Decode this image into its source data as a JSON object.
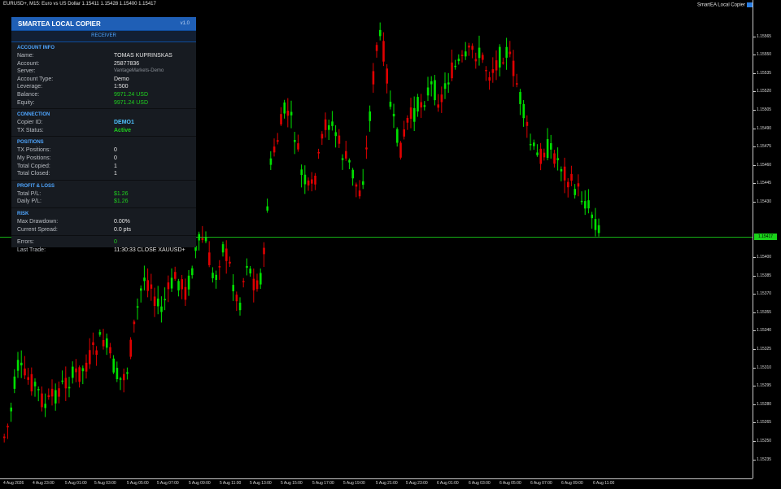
{
  "chart": {
    "title": "EURUSD+, M15:  Euro vs US Dollar  1.15411 1.15428 1.15400 1.15417",
    "ea_label": "SmartEA Local Copier",
    "current_price": "1.15417"
  },
  "price_axis": [
    "1.15565",
    "1.15550",
    "1.15535",
    "1.15520",
    "1.15505",
    "1.15490",
    "1.15475",
    "1.15460",
    "1.15445",
    "1.15430",
    "1.15400",
    "1.15385",
    "1.15370",
    "1.15355",
    "1.15340",
    "1.15325",
    "1.15310",
    "1.15295",
    "1.15280",
    "1.15265",
    "1.15250",
    "1.15235"
  ],
  "time_axis": [
    "4 Aug 2026",
    "4 Aug 23:00",
    "5 Aug 01:00",
    "5 Aug 03:00",
    "5 Aug 05:00",
    "5 Aug 07:00",
    "5 Aug 09:00",
    "5 Aug 11:00",
    "5 Aug 13:00",
    "5 Aug 15:00",
    "5 Aug 17:00",
    "5 Aug 19:00",
    "5 Aug 21:00",
    "5 Aug 23:00",
    "6 Aug 01:00",
    "6 Aug 03:00",
    "6 Aug 05:00",
    "6 Aug 07:00",
    "6 Aug 09:00",
    "6 Aug 11:00"
  ],
  "panel": {
    "title": "SMARTEA LOCAL COPIER",
    "version": "v1.0",
    "mode": "RECEIVER",
    "account": {
      "section": "ACCOUNT INFO",
      "rows": [
        {
          "label": "Name:",
          "value": "TOMAS KUPRINSKAS"
        },
        {
          "label": "Account:",
          "value": "25877836"
        },
        {
          "label": "Server:",
          "value": "VantageMarkets-Demo"
        },
        {
          "label": "Account Type:",
          "value": "Demo"
        },
        {
          "label": "Leverage:",
          "value": "1:500"
        },
        {
          "label": "Balance:",
          "value": "9971.24 USD"
        },
        {
          "label": "Equity:",
          "value": "9971.24 USD"
        }
      ]
    },
    "connection": {
      "section": "CONNECTION",
      "rows": [
        {
          "label": "Copier ID:",
          "value": "DEMO1"
        },
        {
          "label": "TX Status:",
          "value": "Active"
        }
      ]
    },
    "positions": {
      "section": "POSITIONS",
      "rows": [
        {
          "label": "TX Positions:",
          "value": "0"
        },
        {
          "label": "My Positions:",
          "value": "0"
        },
        {
          "label": "Total Copied:",
          "value": "1"
        },
        {
          "label": "Total Closed:",
          "value": "1"
        }
      ]
    },
    "pnl": {
      "section": "PROFIT & LOSS",
      "rows": [
        {
          "label": "Total P/L:",
          "value": "$1.26"
        },
        {
          "label": "Daily P/L:",
          "value": "$1.26"
        }
      ]
    },
    "risk": {
      "section": "RISK",
      "rows": [
        {
          "label": "Max Drawdown:",
          "value": "0.00%"
        },
        {
          "label": "Current Spread:",
          "value": "0.0 pts"
        }
      ]
    },
    "status": {
      "rows": [
        {
          "label": "Errors:",
          "value": "0"
        },
        {
          "label": "Last Trade:",
          "value": "11:30:33 CLOSE XAUUSD+"
        }
      ]
    }
  },
  "colors": {
    "bull": "#00e000",
    "bear": "#e00000",
    "accent": "#1f5fb6",
    "grid": "#c8c8c8"
  }
}
